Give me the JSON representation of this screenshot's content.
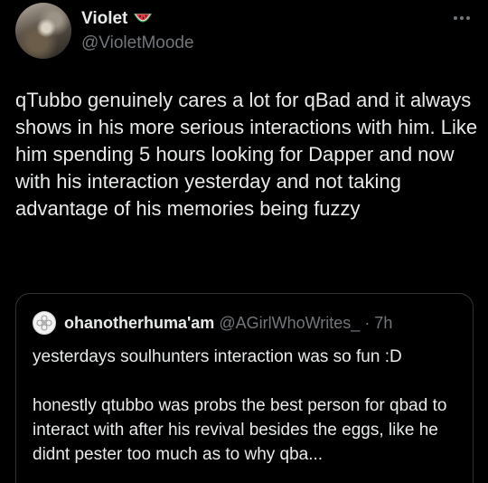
{
  "author": {
    "display_name": "Violet",
    "name_emoji": "watermelon-emoji",
    "handle": "@VioletMoode"
  },
  "more_menu_icon": "ellipsis-icon",
  "tweet": {
    "text": "qTubbo genuinely cares a lot for qBad and it always shows in his more serious interactions with him. Like him spending 5 hours looking for Dapper and now with his interaction yesterday and not taking advantage of his memories being fuzzy"
  },
  "quoted_tweet": {
    "display_name": "ohanotherhuma'am",
    "handle": "@AGirlWhoWrites_",
    "time": "· 7h",
    "paragraphs": [
      "yesterdays soulhunters interaction was so fun :D",
      "honestly qtubbo was probs the best person for qbad to interact with after his revival besides the eggs, like he didnt pester too much as to why qba..."
    ]
  },
  "colors": {
    "background": "#000000",
    "primary_text": "#e7e9ea",
    "secondary_text": "#71767b",
    "border": "#2f3336"
  }
}
